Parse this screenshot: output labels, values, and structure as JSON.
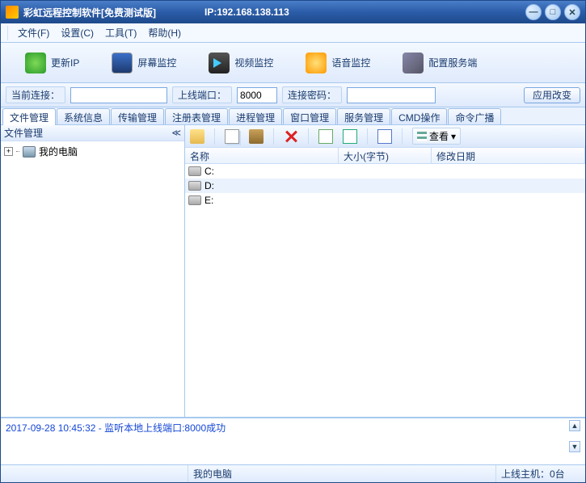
{
  "title": {
    "app": "彩虹远程控制软件[免费测试版]",
    "ip_label": "IP:192.168.138.113"
  },
  "winbuttons": {
    "min": "—",
    "max": "□",
    "close": "✕"
  },
  "menu": {
    "file": "文件(F)",
    "settings": "设置(C)",
    "tools": "工具(T)",
    "help": "帮助(H)"
  },
  "toolbar": {
    "update_ip": "更新IP",
    "screen": "屏幕监控",
    "video": "视频监控",
    "audio": "语音监控",
    "config": "配置服务端"
  },
  "conn": {
    "current_label": "当前连接：",
    "current_value": "",
    "port_label": "上线端口：",
    "port_value": "8000",
    "pwd_label": "连接密码：",
    "pwd_value": "",
    "apply": "应用改变"
  },
  "tabs": [
    "文件管理",
    "系统信息",
    "传输管理",
    "注册表管理",
    "进程管理",
    "窗口管理",
    "服务管理",
    "CMD操作",
    "命令广播"
  ],
  "left": {
    "header": "文件管理",
    "root": "我的电脑"
  },
  "filetb": {
    "view": "查看"
  },
  "cols": {
    "name": "名称",
    "size": "大小(字节)",
    "date": "修改日期"
  },
  "drives": [
    "C:",
    "D:",
    "E:"
  ],
  "log": "2017-09-28 10:45:32 - 监听本地上线端口:8000成功",
  "status": {
    "path": "我的电脑",
    "hosts": "上线主机：0台"
  }
}
